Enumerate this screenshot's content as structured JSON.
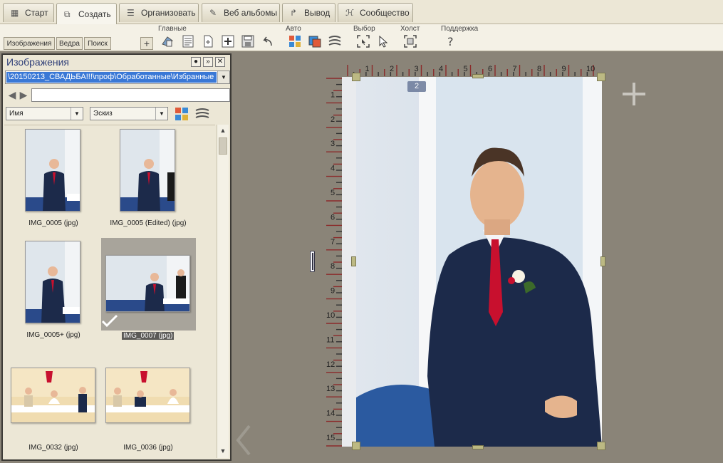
{
  "tabs": [
    {
      "label": "Старт",
      "icon": "grid-icon"
    },
    {
      "label": "Создать",
      "icon": "create-icon",
      "active": true
    },
    {
      "label": "Организовать",
      "icon": "list-icon"
    },
    {
      "label": "Веб альбомы",
      "icon": "album-icon"
    },
    {
      "label": "Вывод",
      "icon": "share-icon"
    },
    {
      "label": "Сообщество",
      "icon": "community-icon"
    }
  ],
  "toolbar_groups": [
    "Главные",
    "Авто",
    "Выбор",
    "Холст",
    "Поддержка"
  ],
  "panel_tabs": [
    "Изображения",
    "Ведра",
    "Поиск"
  ],
  "add_label": "+",
  "panel": {
    "title": "Изображения",
    "path": "\\20150213_СВАДЬБА!!!\\проф\\Обработанные\\Избранные",
    "search_value": "",
    "sort_by": "Имя",
    "view_mode": "Эскиз"
  },
  "thumbnails": [
    {
      "caption": "IMG_0005 (jpg)",
      "selected": false
    },
    {
      "caption": "IMG_0005 (Edited) (jpg)",
      "selected": false
    },
    {
      "caption": "IMG_0005+ (jpg)",
      "selected": false
    },
    {
      "caption": "IMG_0007 (jpg)",
      "selected": true
    },
    {
      "caption": "IMG_0032 (jpg)",
      "selected": false
    },
    {
      "caption": "IMG_0036 (jpg)",
      "selected": false
    }
  ],
  "canvas": {
    "page_number": "2",
    "ruler_top": [
      "1",
      "2",
      "3",
      "4",
      "5",
      "6",
      "7",
      "8",
      "9",
      "10"
    ],
    "ruler_left": [
      "1",
      "2",
      "3",
      "4",
      "5",
      "6",
      "7",
      "8",
      "9",
      "10",
      "11",
      "12",
      "13",
      "14",
      "15"
    ]
  },
  "colors": {
    "accent": "#3a78d6",
    "background": "#8a8478",
    "panel": "#ece7d6",
    "ruler_mark": "#8b2a2a"
  }
}
